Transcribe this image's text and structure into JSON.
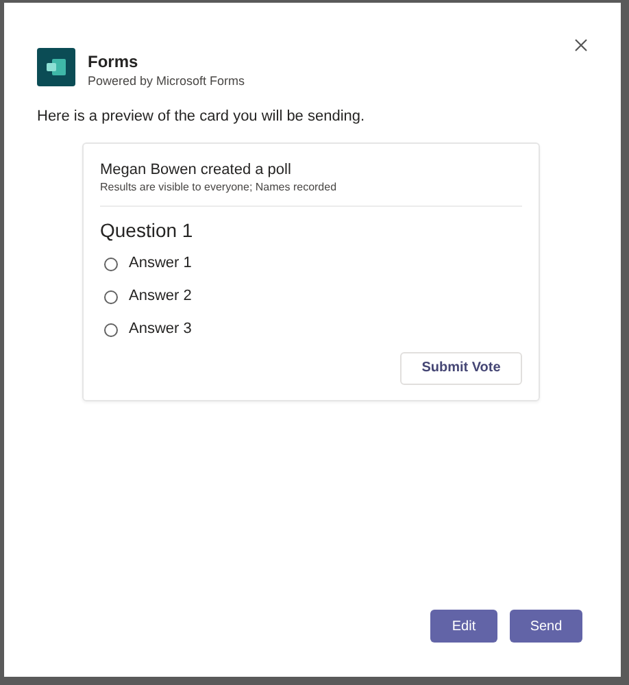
{
  "app": {
    "name": "Forms",
    "subtitle": "Powered by Microsoft Forms"
  },
  "intro": "Here is a preview of the card you will be sending.",
  "card": {
    "title": "Megan Bowen created a poll",
    "subtitle": "Results are visible to everyone; Names recorded",
    "question": "Question 1",
    "answers": [
      {
        "label": "Answer 1",
        "selected": false
      },
      {
        "label": "Answer 2",
        "selected": false
      },
      {
        "label": "Answer 3",
        "selected": false
      }
    ],
    "submit": "Submit Vote"
  },
  "buttons": [
    "Edit",
    "Send"
  ]
}
